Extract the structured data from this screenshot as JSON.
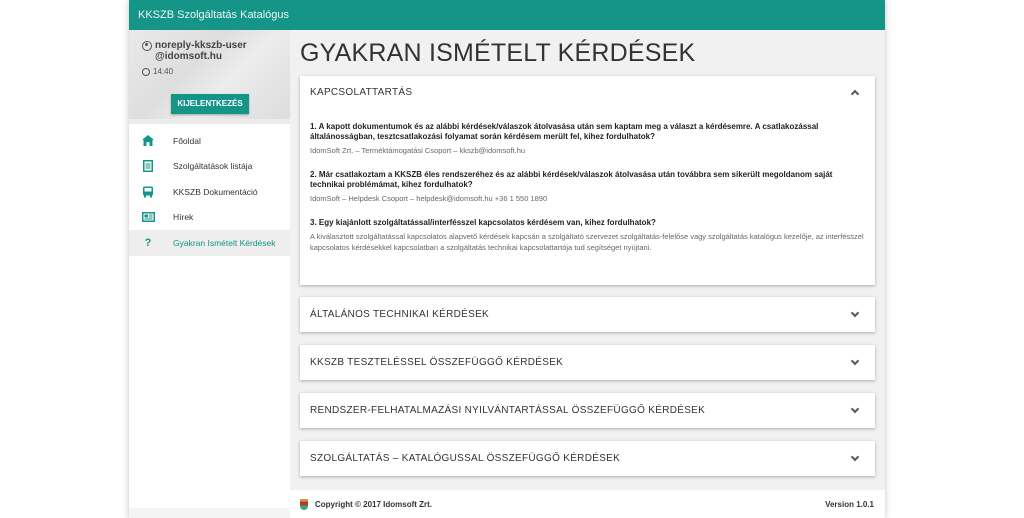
{
  "app": {
    "title": "KKSZB Szolgáltatás Katalógus"
  },
  "user": {
    "email": "noreply-kkszb-user@idomsoft.hu",
    "time": "14:40",
    "logout_label": "KIJELENTKEZÉS"
  },
  "nav": {
    "items": [
      {
        "label": "Főoldal",
        "icon": "home-icon"
      },
      {
        "label": "Szolgáltatások listája",
        "icon": "document-list-icon"
      },
      {
        "label": "KKSZB Dokumentáció",
        "icon": "bus-icon"
      },
      {
        "label": "Hírek",
        "icon": "newspaper-icon"
      },
      {
        "label": "Gyakran Ismételt Kérdések",
        "icon": "question-icon",
        "active": true
      }
    ]
  },
  "page": {
    "title": "GYAKRAN ISMÉTELT KÉRDÉSEK"
  },
  "faq": {
    "sections": [
      {
        "title": "KAPCSOLATTARTÁS",
        "expanded": true,
        "items": [
          {
            "q": "1. A kapott dokumentumok és az alábbi kérdések/válaszok átolvasása után sem kaptam meg a választ a kérdésemre. A csatlakozással általánosságban, tesztcsatlakozási folyamat során kérdésem merült fel, kihez fordulhatok?",
            "a": "IdomSoft Zrt. – Terméktámogatási Csoport – kkszb@idomsoft.hu"
          },
          {
            "q": "2. Már csatlakoztam a KKSZB éles rendszeréhez és az alábbi kérdések/válaszok átolvasása után továbbra sem sikerült megoldanom saját technikai problémámat, kihez fordulhatok?",
            "a": "IdomSoft – Helpdesk Csoport – helpdesk@idomsoft.hu +36 1 550 1890"
          },
          {
            "q": "3. Egy kiajánlott szolgáltatással/interfésszel kapcsolatos kérdésem van, kihez fordulhatok?",
            "a": "A kiválasztott szolgáltatással kapcsolatos alapvető kérdések kapcsán a szolgáltató szervezet szolgáltatás-felelőse vagy szolgáltatás katalógus kezelője, az interfésszel kapcsolatos kérdésekkel kapcsolatban a szolgáltatás technikai kapcsolattartója tud segítséget nyújtani."
          }
        ]
      },
      {
        "title": "ÁLTALÁNOS TECHNIKAI KÉRDÉSEK",
        "expanded": false
      },
      {
        "title": "KKSZB TESZTELÉSSEL ÖSSZEFÜGGŐ KÉRDÉSEK",
        "expanded": false
      },
      {
        "title": "RENDSZER-FELHATALMAZÁSI NYILVÁNTARTÁSSAL ÖSSZEFÜGGŐ KÉRDÉSEK",
        "expanded": false
      },
      {
        "title": "SZOLGÁLTATÁS – KATALÓGUSSAL ÖSSZEFÜGGŐ KÉRDÉSEK",
        "expanded": false
      }
    ]
  },
  "footer": {
    "copyright": "Copyright © 2017 Idomsoft Zrt.",
    "version": "Version 1.0.1"
  },
  "colors": {
    "accent": "#159488"
  }
}
